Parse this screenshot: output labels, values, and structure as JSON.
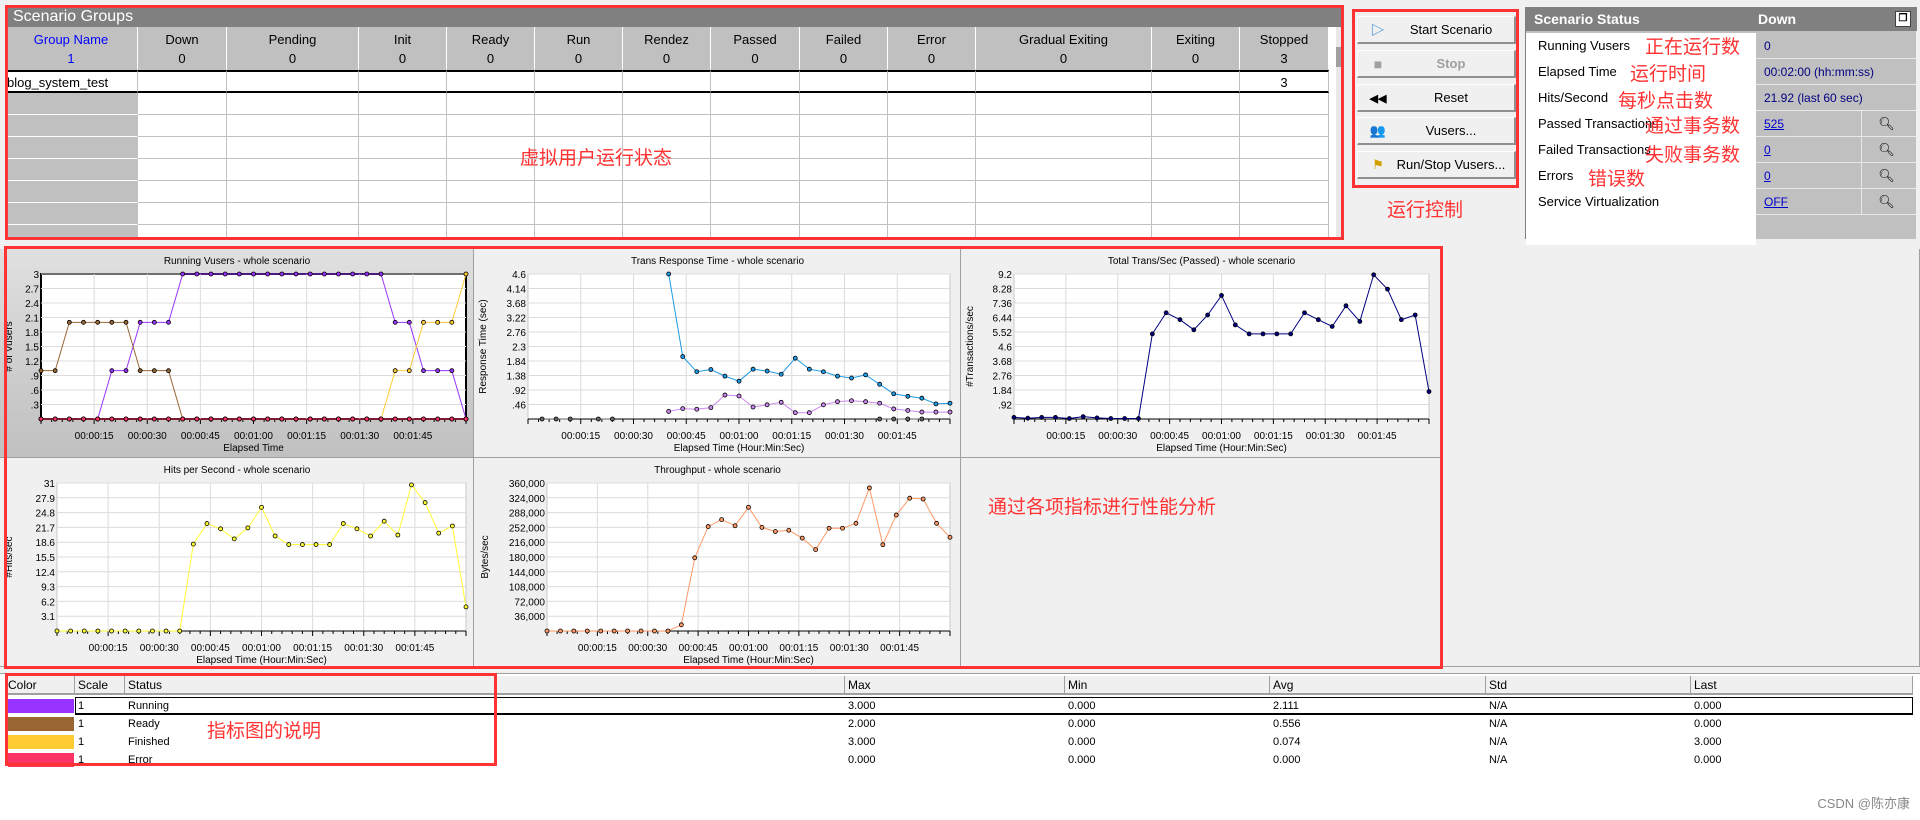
{
  "scenario_groups": {
    "title": "Scenario Groups",
    "columns": [
      {
        "label": "Group Name",
        "count": "1"
      },
      {
        "label": "Down",
        "count": "0"
      },
      {
        "label": "Pending",
        "count": "0"
      },
      {
        "label": "Init",
        "count": "0"
      },
      {
        "label": "Ready",
        "count": "0"
      },
      {
        "label": "Run",
        "count": "0"
      },
      {
        "label": "Rendez",
        "count": "0"
      },
      {
        "label": "Passed",
        "count": "0"
      },
      {
        "label": "Failed",
        "count": "0"
      },
      {
        "label": "Error",
        "count": "0"
      },
      {
        "label": "Gradual Exiting",
        "count": "0"
      },
      {
        "label": "Exiting",
        "count": "0"
      },
      {
        "label": "Stopped",
        "count": "3"
      }
    ],
    "rows": [
      {
        "cells": [
          "blog_system_test",
          "",
          "",
          "",
          "",
          "",
          "",
          "",
          "",
          "",
          "",
          "",
          "3"
        ]
      }
    ]
  },
  "controls": {
    "buttons": [
      {
        "label": "Start Scenario",
        "icon": "play-icon",
        "enabled": true
      },
      {
        "label": "Stop",
        "icon": "stop-icon",
        "enabled": false
      },
      {
        "label": "Reset",
        "icon": "rewind-icon",
        "enabled": true
      },
      {
        "label": "Vusers...",
        "icon": "users-icon",
        "enabled": true
      },
      {
        "label": "Run/Stop Vusers...",
        "icon": "run-stop-vusers-icon",
        "enabled": true
      }
    ]
  },
  "scenario_status": {
    "title": "Scenario Status",
    "state": "Down",
    "rows": [
      {
        "label": "Running Vusers",
        "value": "0",
        "link": false,
        "details": false
      },
      {
        "label": "Elapsed Time",
        "value": "00:02:00 (hh:mm:ss)",
        "link": false,
        "details": false
      },
      {
        "label": "Hits/Second",
        "value": "21.92 (last 60 sec)",
        "link": false,
        "details": false
      },
      {
        "label": "Passed Transactions",
        "value": "525",
        "link": true,
        "details": true
      },
      {
        "label": "Failed Transactions",
        "value": "0",
        "link": true,
        "details": true
      },
      {
        "label": "Errors",
        "value": "0",
        "link": true,
        "details": true
      },
      {
        "label": "Service Virtualization",
        "value": "OFF",
        "link": true,
        "details": true
      }
    ]
  },
  "annotations": {
    "vuser_status": "虚拟用户运行状态",
    "run_control": "运行控制",
    "running_count": "正在运行数",
    "elapsed": "运行时间",
    "hits_per_second": "每秒点击数",
    "passed_tx": "通过事务数",
    "failed_tx": "失败事务数",
    "errors": "错误数",
    "metrics_analysis": "通过各项指标进行性能分析",
    "legend_note": "指标图的说明"
  },
  "colors": {
    "accent_red": "#ff3333",
    "header_gray": "#808080"
  },
  "chart_data": [
    {
      "type": "line",
      "title": "Running Vusers - whole scenario",
      "xlabel": "Elapsed Time",
      "ylabel": "# of Vusers",
      "xlim": [
        "00:00:00",
        "00:02:00"
      ],
      "ylim": [
        0,
        3
      ],
      "xticks": [
        "00:00:15",
        "00:00:30",
        "00:00:45",
        "00:01:00",
        "00:01:15",
        "00:01:30",
        "00:01:45"
      ],
      "yticks": [
        "3",
        "2.7",
        "2.4",
        "2.1",
        "1.8",
        "1.5",
        "1.2",
        ".9",
        ".6",
        ".3"
      ],
      "grid": true,
      "sample_every_sec": 4,
      "series": [
        {
          "name": "Running",
          "color": "#9933ff",
          "values": [
            0,
            0,
            0,
            0,
            0,
            1,
            1,
            2,
            2,
            2,
            3,
            3,
            3,
            3,
            3,
            3,
            3,
            3,
            3,
            3,
            3,
            3,
            3,
            3,
            3,
            2,
            2,
            1,
            1,
            1,
            0
          ]
        },
        {
          "name": "Ready",
          "color": "#996633",
          "values": [
            1,
            1,
            2,
            2,
            2,
            2,
            2,
            1,
            1,
            1,
            0,
            0,
            0,
            0,
            0,
            0,
            0,
            0,
            0,
            0,
            0,
            0,
            0,
            0,
            0,
            0,
            0,
            0,
            0,
            0,
            0
          ]
        },
        {
          "name": "Finished",
          "color": "#ffcc33",
          "values": [
            0,
            0,
            0,
            0,
            0,
            0,
            0,
            0,
            0,
            0,
            0,
            0,
            0,
            0,
            0,
            0,
            0,
            0,
            0,
            0,
            0,
            0,
            0,
            0,
            0,
            1,
            1,
            2,
            2,
            2,
            3
          ]
        },
        {
          "name": "Error",
          "color": "#ff3366",
          "values": [
            0,
            0,
            0,
            0,
            0,
            0,
            0,
            0,
            0,
            0,
            0,
            0,
            0,
            0,
            0,
            0,
            0,
            0,
            0,
            0,
            0,
            0,
            0,
            0,
            0,
            0,
            0,
            0,
            0,
            0,
            0
          ]
        }
      ]
    },
    {
      "type": "line",
      "title": "Trans Response Time - whole scenario",
      "xlabel": "Elapsed Time (Hour:Min:Sec)",
      "ylabel": "Response Time (sec)",
      "xlim": [
        "00:00:00",
        "00:02:00"
      ],
      "ylim": [
        0,
        4.6
      ],
      "xticks": [
        "00:00:15",
        "00:00:30",
        "00:00:45",
        "00:01:00",
        "00:01:15",
        "00:01:30",
        "00:01:45"
      ],
      "yticks": [
        "4.6",
        "4.14",
        "3.68",
        "3.22",
        "2.76",
        "2.3",
        "1.84",
        "1.38",
        ".92",
        ".46"
      ],
      "grid": true,
      "sample_every_sec": 4,
      "series": [
        {
          "color": "#1e9be6",
          "values": [
            null,
            null,
            null,
            null,
            null,
            null,
            null,
            null,
            null,
            null,
            4.6,
            1.98,
            1.5,
            1.57,
            1.36,
            1.2,
            1.58,
            1.52,
            1.42,
            1.93,
            1.58,
            1.5,
            1.36,
            1.3,
            1.4,
            1.1,
            0.8,
            0.72,
            0.66,
            0.48,
            0.5
          ]
        },
        {
          "color": "#cc88ee",
          "values": [
            null,
            null,
            null,
            null,
            null,
            null,
            null,
            null,
            null,
            null,
            0.24,
            0.33,
            0.31,
            0.36,
            0.76,
            0.73,
            0.38,
            0.45,
            0.53,
            0.2,
            0.2,
            0.45,
            0.55,
            0.58,
            0.55,
            0.5,
            0.32,
            0.27,
            0.22,
            0.22,
            0.22
          ]
        },
        {
          "color": "#666666",
          "values": [
            null,
            0,
            0,
            0,
            null,
            0,
            0,
            null,
            null,
            null,
            null,
            null,
            null,
            null,
            null,
            null,
            null,
            null,
            null,
            null,
            null,
            null,
            null,
            null,
            null,
            0,
            0,
            0,
            0,
            null,
            null
          ]
        }
      ]
    },
    {
      "type": "line",
      "title": "Total Trans/Sec (Passed) - whole scenario",
      "xlabel": "Elapsed Time (Hour:Min:Sec)",
      "ylabel": "#Transactions/sec",
      "xlim": [
        "00:00:00",
        "00:02:00"
      ],
      "ylim": [
        0,
        9.2
      ],
      "xticks": [
        "00:00:15",
        "00:00:30",
        "00:00:45",
        "00:01:00",
        "00:01:15",
        "00:01:30",
        "00:01:45"
      ],
      "yticks": [
        "9.2",
        "8.28",
        "7.36",
        "6.44",
        "5.52",
        "4.6",
        "3.68",
        "2.76",
        "1.84",
        ".92"
      ],
      "grid": true,
      "sample_every_sec": 4,
      "series": [
        {
          "color": "#000080",
          "values": [
            0.1,
            0.05,
            0.1,
            0.1,
            0.03,
            0.15,
            0.07,
            0.03,
            0.03,
            0.03,
            5.4,
            6.74,
            6.3,
            5.66,
            6.6,
            7.84,
            5.97,
            5.4,
            5.4,
            5.4,
            5.4,
            6.74,
            6.3,
            5.87,
            7.18,
            6.19,
            9.15,
            8.24,
            6.3,
            6.6,
            1.74
          ]
        }
      ]
    },
    {
      "type": "line",
      "title": "Hits per Second - whole scenario",
      "xlabel": "Elapsed Time (Hour:Min:Sec)",
      "ylabel": "#Hits/sec",
      "xlim": [
        "00:00:00",
        "00:02:00"
      ],
      "ylim": [
        0,
        31
      ],
      "xticks": [
        "00:00:15",
        "00:00:30",
        "00:00:45",
        "00:01:00",
        "00:01:15",
        "00:01:30",
        "00:01:45"
      ],
      "yticks": [
        "31",
        "27.9",
        "24.8",
        "21.7",
        "18.6",
        "15.5",
        "12.4",
        "9.3",
        "6.2",
        "3.1"
      ],
      "grid": true,
      "sample_every_sec": 4,
      "series": [
        {
          "color": "#ffff33",
          "values": [
            0,
            0,
            0,
            0,
            0,
            0,
            0,
            0,
            0,
            0,
            18.2,
            22.5,
            21.4,
            19.3,
            21.6,
            25.9,
            19.9,
            18.1,
            18.1,
            18.1,
            18.1,
            22.5,
            21.4,
            19.9,
            23,
            20.1,
            30.6,
            26.9,
            20.5,
            22,
            5.05
          ]
        }
      ]
    },
    {
      "type": "line",
      "title": "Throughput - whole scenario",
      "xlabel": "Elapsed Time (Hour:Min:Sec)",
      "ylabel": "Bytes/sec",
      "xlim": [
        "00:00:00",
        "00:02:00"
      ],
      "ylim": [
        0,
        360000
      ],
      "xticks": [
        "00:00:15",
        "00:00:30",
        "00:00:45",
        "00:01:00",
        "00:01:15",
        "00:01:30",
        "00:01:45"
      ],
      "yticks": [
        "360,000",
        "324,000",
        "288,000",
        "252,000",
        "216,000",
        "180,000",
        "144,000",
        "108,000",
        "72,000",
        "36,000"
      ],
      "grid": true,
      "sample_every_sec": 4,
      "series": [
        {
          "color": "#ff9966",
          "values": [
            0,
            0,
            0,
            0,
            0,
            0,
            0,
            0,
            0,
            0,
            15000,
            178000,
            254000,
            271000,
            256000,
            301000,
            252000,
            242000,
            245000,
            226000,
            198000,
            250000,
            250000,
            262000,
            348000,
            210000,
            282000,
            323000,
            321000,
            262000,
            228000
          ]
        }
      ]
    }
  ],
  "legend_table": {
    "columns": [
      "Color",
      "Scale",
      "Status",
      "Max",
      "Min",
      "Avg",
      "Std",
      "Last"
    ],
    "rows": [
      {
        "color": "#9933ff",
        "scale": "1",
        "status": "Running",
        "max": "3.000",
        "min": "0.000",
        "avg": "2.111",
        "std": "N/A",
        "last": "0.000"
      },
      {
        "color": "#996633",
        "scale": "1",
        "status": "Ready",
        "max": "2.000",
        "min": "0.000",
        "avg": "0.556",
        "std": "N/A",
        "last": "0.000"
      },
      {
        "color": "#ffcc33",
        "scale": "1",
        "status": "Finished",
        "max": "3.000",
        "min": "0.000",
        "avg": "0.074",
        "std": "N/A",
        "last": "3.000"
      },
      {
        "color": "#ff3366",
        "scale": "1",
        "status": "Error",
        "max": "0.000",
        "min": "0.000",
        "avg": "0.000",
        "std": "N/A",
        "last": "0.000"
      }
    ]
  },
  "watermark": "CSDN @陈亦康"
}
